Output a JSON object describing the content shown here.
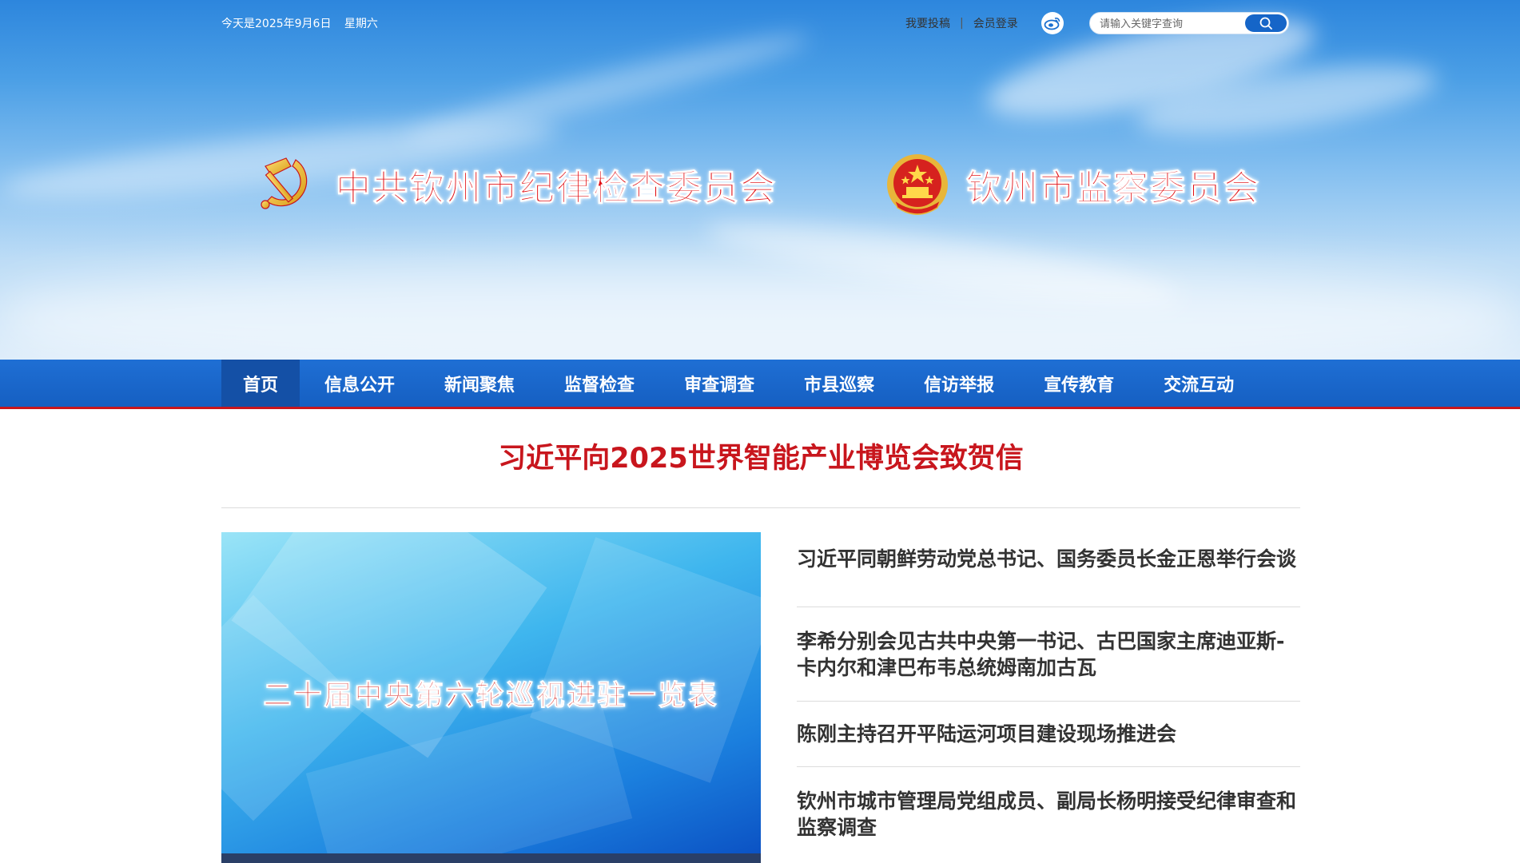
{
  "topbar": {
    "date": "今天是2025年9月6日",
    "weekday": "星期六",
    "submit_link": "我要投稿",
    "separator": "|",
    "login_link": "会员登录",
    "search_placeholder": "请输入关键字查询"
  },
  "brand": {
    "left_title": "中共钦州市纪律检查委员会",
    "right_title": "钦州市监察委员会",
    "left_emblem": "party-emblem-icon",
    "right_emblem": "national-emblem-icon",
    "title_color": "#e10d12"
  },
  "nav": {
    "items": [
      "首页",
      "信息公开",
      "新闻聚焦",
      "监督检查",
      "审查调查",
      "市县巡察",
      "信访举报",
      "宣传教育",
      "交流互动"
    ],
    "active_index": 0,
    "bar_color": "#155fc2",
    "underline_color": "#c8161d"
  },
  "headline": "习近平向2025世界智能产业博览会致贺信",
  "feature": {
    "caption": "二十届中央第六轮巡视进驻一览表"
  },
  "news": [
    "习近平同朝鲜劳动党总书记、国务委员长金正恩举行会谈",
    "李希分别会见古共中央第一书记、古巴国家主席迪亚斯-卡内尔和津巴布韦总统姆南加古瓦",
    "陈刚主持召开平陆运河项目建设现场推进会",
    "钦州市城市管理局党组成员、副局长杨明接受纪律审查和监察调查"
  ]
}
